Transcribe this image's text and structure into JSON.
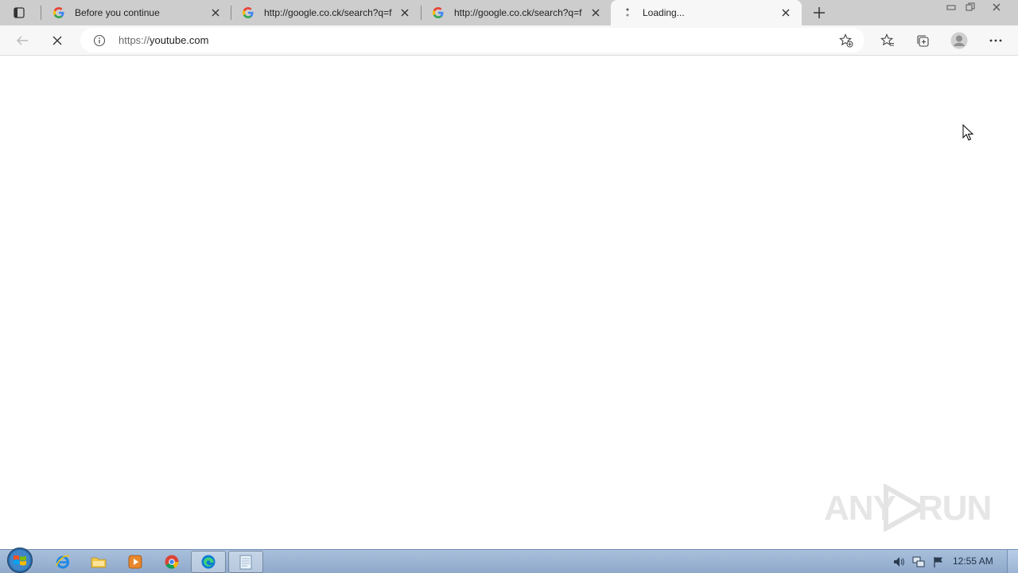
{
  "browser": {
    "tabs": [
      {
        "title": "Before you continue",
        "favicon": "google-icon"
      },
      {
        "title": "http://google.co.ck/search?q=f",
        "favicon": "google-icon"
      },
      {
        "title": "http://google.co.ck/search?q=f",
        "favicon": "google-icon"
      },
      {
        "title": "Loading...",
        "favicon": "loading-spinner-icon",
        "active": true
      }
    ],
    "address_bar": {
      "scheme": "https://",
      "host": "youtube.com"
    }
  },
  "watermark": {
    "left": "ANY",
    "right": "RUN"
  },
  "taskbar": {
    "apps": [
      "internet-explorer-icon",
      "file-explorer-icon",
      "media-player-icon",
      "chrome-icon",
      "edge-icon",
      "notepad-icon"
    ],
    "clock": "12:55 AM"
  },
  "colors": {
    "tabstrip": "#cdcdcd",
    "toolbar": "#f7f7f7",
    "taskbar": "#9fb6d6"
  }
}
